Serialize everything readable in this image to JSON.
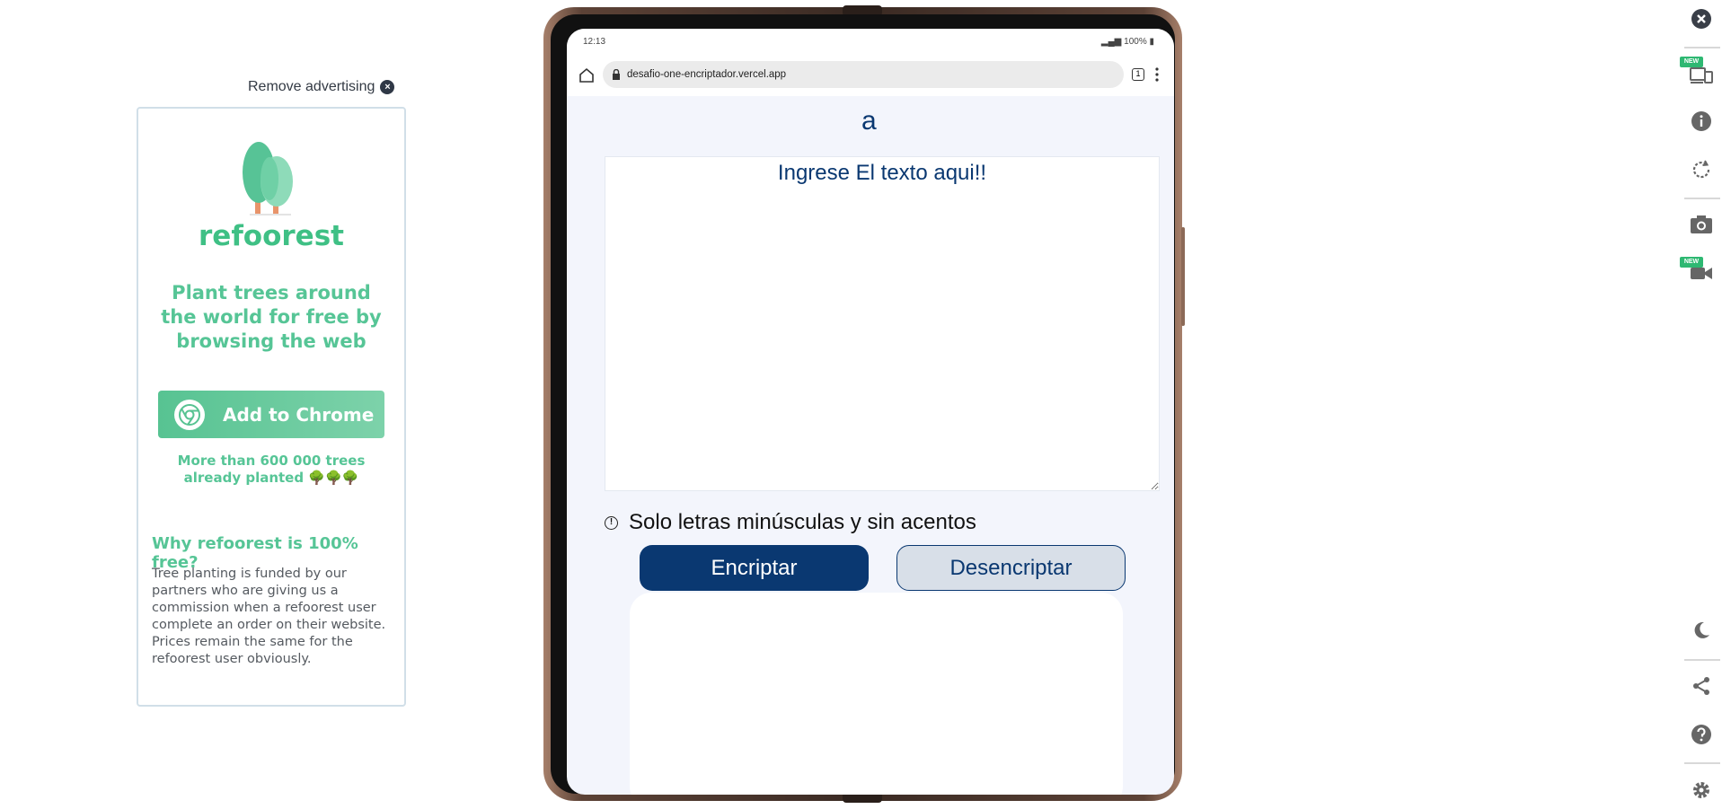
{
  "ad": {
    "remove_label": "Remove advertising",
    "brand": "refoorest",
    "tagline": "Plant trees around the world for free by browsing the web",
    "cta_label": "Add to Chrome",
    "count_text": "More than 600 000 trees already planted 🌳🌳🌳",
    "why_title": "Why refoorest is 100% free?",
    "why_text": "Tree planting is funded by our partners who are giving us a commission when a refoorest user complete an order on their website. Prices remain the same for the refoorest user obviously.",
    "accent_color": "#56c596"
  },
  "device": {
    "status_time": "12:13",
    "status_battery": "100%",
    "url": "desafio-one-encriptador.vercel.app",
    "tab_count": "1"
  },
  "app": {
    "logo": "a",
    "input_placeholder": "Ingrese El texto aqui!!",
    "hint": "Solo letras minúsculas y sin acentos",
    "encrypt_label": "Encriptar",
    "decrypt_label": "Desencriptar",
    "primary_color": "#0a3871"
  },
  "toolbar": {
    "new_badge": "NEW",
    "icons": [
      "close-icon",
      "devices-icon",
      "info-icon",
      "rotate-icon",
      "camera-icon",
      "video-icon",
      "moon-icon",
      "share-icon",
      "help-icon",
      "gear-icon"
    ]
  }
}
